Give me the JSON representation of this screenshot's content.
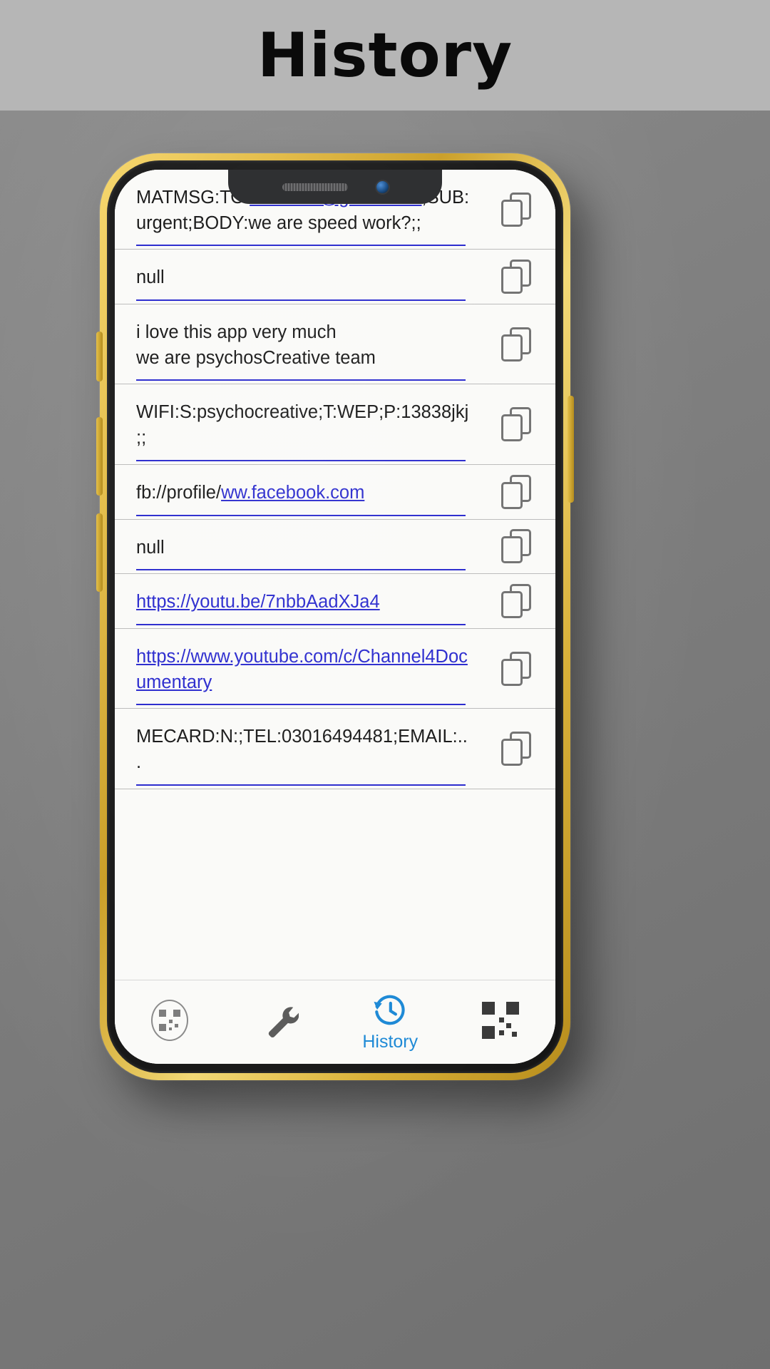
{
  "banner": {
    "title": "History"
  },
  "colors": {
    "link": "#2222cc",
    "accent": "#1f8ad6",
    "banner_bg": "#b6b6b6",
    "phone_frame": "#e3bb43",
    "screen_bg": "#fafaf8"
  },
  "history": {
    "rows": [
      {
        "id": "row-matmsg",
        "segments": [
          {
            "text": "MATMSG:TO:",
            "link": false
          },
          {
            "text": "1233466@gmail.com",
            "link": true
          },
          {
            "text": ";SUB:urgent;BODY:we are speed work?;;",
            "link": false
          }
        ],
        "copy_label": "copy"
      },
      {
        "id": "row-null-1",
        "segments": [
          {
            "text": "null",
            "link": false
          }
        ],
        "copy_label": "copy"
      },
      {
        "id": "row-plaintext",
        "segments": [
          {
            "text": "i love this app very much\nwe are psychosCreative team",
            "link": false
          }
        ],
        "copy_label": "copy"
      },
      {
        "id": "row-wifi",
        "segments": [
          {
            "text": "WIFI:S:psychocreative;T:WEP;P:13838jkj;;",
            "link": false
          }
        ],
        "copy_label": "copy"
      },
      {
        "id": "row-fb",
        "segments": [
          {
            "text": "fb://profile/",
            "link": false
          },
          {
            "text": "ww.facebook.com",
            "link": true
          }
        ],
        "copy_label": "copy"
      },
      {
        "id": "row-null-2",
        "segments": [
          {
            "text": "null",
            "link": false
          }
        ],
        "copy_label": "copy"
      },
      {
        "id": "row-youtu-be",
        "segments": [
          {
            "text": "https://youtu.be/7nbbAadXJa4",
            "link": true
          }
        ],
        "copy_label": "copy"
      },
      {
        "id": "row-youtube-channel",
        "segments": [
          {
            "text": "https://www.youtube.com/c/Channel4Documentary",
            "link": true
          }
        ],
        "copy_label": "copy"
      },
      {
        "id": "row-mecard",
        "segments": [
          {
            "text": "MECARD:N:;TEL:03016494481;EMAIL:...",
            "link": false
          }
        ],
        "copy_label": "copy"
      }
    ]
  },
  "navbar": {
    "items": [
      {
        "id": "nav-scan",
        "icon": "qr-scan-icon",
        "label": ""
      },
      {
        "id": "nav-tools",
        "icon": "wrench-icon",
        "label": ""
      },
      {
        "id": "nav-history",
        "icon": "history-icon",
        "label": "History"
      },
      {
        "id": "nav-generate",
        "icon": "qr-code-icon",
        "label": ""
      }
    ]
  }
}
